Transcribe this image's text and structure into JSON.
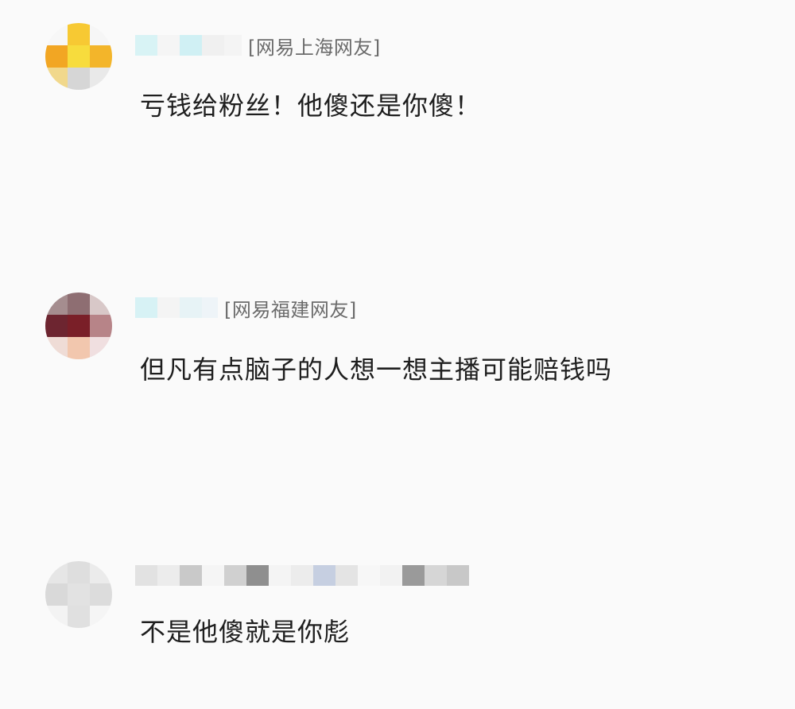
{
  "comments": [
    {
      "source": "[网易上海网友]",
      "text": "亏钱给粉丝！他傻还是你傻！"
    },
    {
      "source": "[网易福建网友]",
      "text": "但凡有点脑子的人想一想主播可能赔钱吗"
    },
    {
      "source": "",
      "text": "不是他傻就是你彪"
    }
  ],
  "colors": {
    "background": "#fafafa",
    "text": "#1e1e1e",
    "source": "#6b6b6b"
  }
}
